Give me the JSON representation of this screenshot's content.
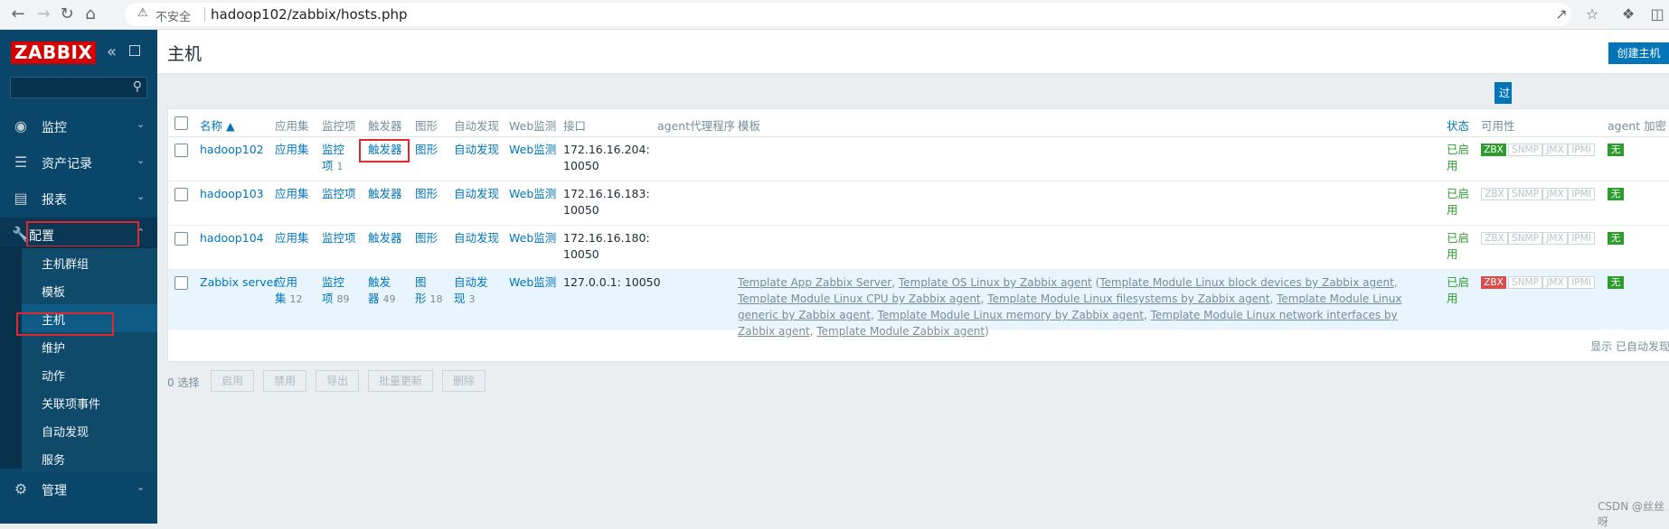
{
  "browser": {
    "back_icon": "arrow-left-icon",
    "forward_icon": "arrow-right-icon",
    "reload_icon": "reload-icon",
    "home_icon": "home-icon",
    "insecure_label": "不安全",
    "url": "hadoop102/zabbix/hosts.php"
  },
  "sidebar": {
    "logo": "ZABBIX",
    "search_value": "",
    "menu": [
      {
        "label": "监控",
        "icon": "eye-icon"
      },
      {
        "label": "资产记录",
        "icon": "list-icon"
      },
      {
        "label": "报表",
        "icon": "bar-chart-icon"
      },
      {
        "label": "配置",
        "icon": "wrench-icon"
      },
      {
        "label": "管理",
        "icon": "gear-icon"
      }
    ],
    "config_submenu": [
      "主机群组",
      "模板",
      "主机",
      "维护",
      "动作",
      "关联项事件",
      "自动发现",
      "服务"
    ]
  },
  "header": {
    "title": "主机",
    "create_button": "创建主机",
    "filter_button": "过"
  },
  "table": {
    "columns": {
      "name": "名称 ▲",
      "applications": "应用集",
      "items": "监控项",
      "triggers": "触发器",
      "graphs": "图形",
      "discovery": "自动发现",
      "web": "Web监测",
      "interface": "接口",
      "proxy": "agent代理程序",
      "templates": "模板",
      "status": "状态",
      "availability": "可用性",
      "encryption": "agent 加密"
    },
    "rows": [
      {
        "name": "hadoop102",
        "app": "应用集",
        "app_count": "",
        "items_1": "监控",
        "items_2": "项",
        "items_count": "1",
        "triggers": "触发器",
        "triggers_count": "",
        "graphs": "图形",
        "graphs_count": "",
        "discovery": "自动发现",
        "discovery_count": "",
        "web": "Web监测",
        "interface_1": "172.16.16.204:",
        "interface_2": "10050",
        "status_1": "已启",
        "status_2": "用",
        "zbx": "ZBX",
        "snmp": "SNMP",
        "jmx": "JMX",
        "ipmi": "IPMI",
        "encryption": "无"
      },
      {
        "name": "hadoop103",
        "app": "应用集",
        "items": "监控项",
        "triggers": "触发器",
        "graphs": "图形",
        "discovery": "自动发现",
        "web": "Web监测",
        "interface_1": "172.16.16.183:",
        "interface_2": "10050",
        "status_1": "已启",
        "status_2": "用",
        "zbx": "ZBX",
        "snmp": "SNMP",
        "jmx": "JMX",
        "ipmi": "IPMI",
        "encryption": "无"
      },
      {
        "name": "hadoop104",
        "app": "应用集",
        "items": "监控项",
        "triggers": "触发器",
        "graphs": "图形",
        "discovery": "自动发现",
        "web": "Web监测",
        "interface_1": "172.16.16.180:",
        "interface_2": "10050",
        "status_1": "已启",
        "status_2": "用",
        "zbx": "ZBX",
        "snmp": "SNMP",
        "jmx": "JMX",
        "ipmi": "IPMI",
        "encryption": "无"
      },
      {
        "name": "Zabbix server",
        "app_1": "应用",
        "app_2": "集",
        "app_count": "12",
        "items_1": "监控",
        "items_2": "项",
        "items_count": "89",
        "triggers_1": "触发",
        "triggers_2": "器",
        "triggers_count": "49",
        "graphs_1": "图",
        "graphs_2": "形",
        "graphs_count": "18",
        "discovery_1": "自动发",
        "discovery_2": "现",
        "discovery_count": "3",
        "web": "Web监测",
        "interface": "127.0.0.1: 10050",
        "templates": {
          "t1": "Template App Zabbix Server",
          "t2": "Template OS Linux by Zabbix agent",
          "t3": "Template Module Linux block devices by Zabbix agent",
          "t4": "Template Module Linux CPU by Zabbix agent",
          "t5": "Template Module Linux filesystems by Zabbix agent",
          "t6": "Template Module Linux generic by Zabbix agent",
          "t7": "Template Module Linux memory by Zabbix agent",
          "t8": "Template Module Linux network interfaces by Zabbix agent",
          "t9": "Template Module Zabbix agent"
        },
        "status_1": "已启",
        "status_2": "用",
        "zbx": "ZBX",
        "snmp": "SNMP",
        "jmx": "JMX",
        "ipmi": "IPMI",
        "encryption": "无"
      }
    ],
    "showing": "显示 已自动发现"
  },
  "footer": {
    "selected": "0 选择",
    "enable": "启用",
    "disable": "禁用",
    "export": "导出",
    "mass_update": "批量更新",
    "delete": "删除"
  },
  "watermark": "CSDN @丝丝呀"
}
